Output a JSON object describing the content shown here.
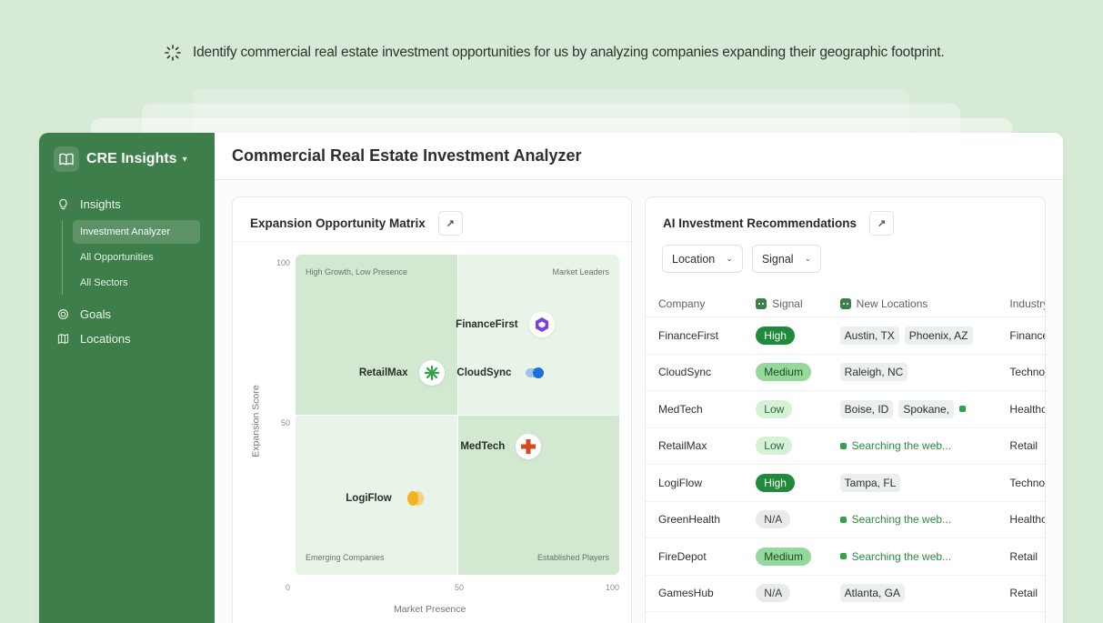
{
  "prompt": {
    "text": "Identify commercial real estate investment opportunities for us by analyzing companies expanding their geographic footprint."
  },
  "sidebar": {
    "brand": "CRE Insights",
    "items": {
      "insights": "Insights",
      "analyzer": "Investment Analyzer",
      "opportunities": "All Opportunities",
      "sectors": "All Sectors",
      "goals": "Goals",
      "locations": "Locations"
    }
  },
  "header": {
    "title": "Commercial Real Estate Investment Analyzer"
  },
  "matrix": {
    "title": "Expansion Opportunity Matrix",
    "quadrants": {
      "tl": "High Growth, Low Presence",
      "tr": "Market Leaders",
      "bl": "Emerging Companies",
      "br": "Established Players"
    },
    "xlabel": "Market Presence",
    "ylabel": "Expansion Score",
    "xticks": [
      "0",
      "50",
      "100"
    ],
    "yticks": [
      "100",
      "50"
    ]
  },
  "chart_data": {
    "type": "scatter",
    "xlabel": "Market Presence",
    "ylabel": "Expansion Score",
    "xlim": [
      0,
      100
    ],
    "ylim": [
      0,
      100
    ],
    "points": [
      {
        "label": "FinanceFirst",
        "x": 76,
        "y": 78
      },
      {
        "label": "RetailMax",
        "x": 42,
        "y": 63
      },
      {
        "label": "CloudSync",
        "x": 74,
        "y": 63
      },
      {
        "label": "MedTech",
        "x": 72,
        "y": 40
      },
      {
        "label": "LogiFlow",
        "x": 37,
        "y": 24
      }
    ]
  },
  "recs": {
    "title": "AI Investment Recommendations",
    "filters": {
      "location": "Location",
      "signal": "Signal"
    },
    "columns": {
      "company": "Company",
      "signal": "Signal",
      "locations": "New Locations",
      "industry": "Industry"
    },
    "rows": [
      {
        "company": "FinanceFirst",
        "signal": "High",
        "locations": [
          "Austin, TX",
          "Phoenix, AZ"
        ],
        "industry": "Finance"
      },
      {
        "company": "CloudSync",
        "signal": "Medium",
        "locations": [
          "Raleigh, NC"
        ],
        "industry": "Technology"
      },
      {
        "company": "MedTech",
        "signal": "Low",
        "locations": [
          "Boise, ID",
          "Spokane,"
        ],
        "industry": "Healthcare"
      },
      {
        "company": "RetailMax",
        "signal": "Low",
        "searching": "Searching the web...",
        "industry": "Retail"
      },
      {
        "company": "LogiFlow",
        "signal": "High",
        "locations": [
          "Tampa, FL"
        ],
        "industry": "Technology"
      },
      {
        "company": "GreenHealth",
        "signal": "N/A",
        "searching": "Searching the web...",
        "industry": "Healthcare"
      },
      {
        "company": "FireDepot",
        "signal": "Medium",
        "searching": "Searching the web...",
        "industry": "Retail"
      },
      {
        "company": "GamesHub",
        "signal": "N/A",
        "locations": [
          "Atlanta, GA"
        ],
        "industry": "Retail"
      }
    ]
  },
  "colors": {
    "sidebar": "#3e7e4a",
    "background": "#d7ead6",
    "signal_high": "#1f8a3a",
    "signal_medium": "#95d89b",
    "signal_low": "#d6f1d5",
    "signal_na": "#e8ebe9",
    "financefirst_icon": "#7b3fe4",
    "cloudsync_icon": "#1e6fd9",
    "medtech_icon": "#d9481f",
    "logiflow_icon": "#f2b323",
    "retailmax_icon": "#2ea34a"
  }
}
